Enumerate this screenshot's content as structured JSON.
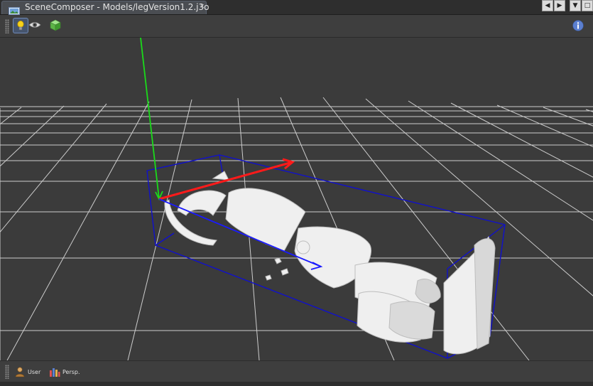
{
  "tab": {
    "title": "SceneComposer - Models/legVersion1.2.j3o",
    "close_glyph": "x",
    "icon": "image-file-icon"
  },
  "window_controls": {
    "prev_glyph": "◀",
    "next_glyph": "▶",
    "menu_glyph": "▼",
    "maximize_glyph": "□"
  },
  "toolbar": {
    "buttons": [
      {
        "icon": "light-bulb-icon",
        "active": true
      },
      {
        "icon": "eye-icon",
        "active": false
      },
      {
        "icon": "cube-icon",
        "active": false
      }
    ],
    "info_icon": "info-icon"
  },
  "viewport": {
    "background": "#3b3b3b",
    "axis_colors": {
      "x": "#ff1a1a",
      "y": "#1adb1a",
      "z": "#1a1aff"
    },
    "bounding_box_color": "#1010cc",
    "grid_color": "#d9d9d9"
  },
  "statusbar": {
    "camera_user_label": "User",
    "camera_persp_label": "Persp."
  },
  "colors": {
    "accent": "#6f8ab8",
    "info": "#5b7fd0"
  }
}
